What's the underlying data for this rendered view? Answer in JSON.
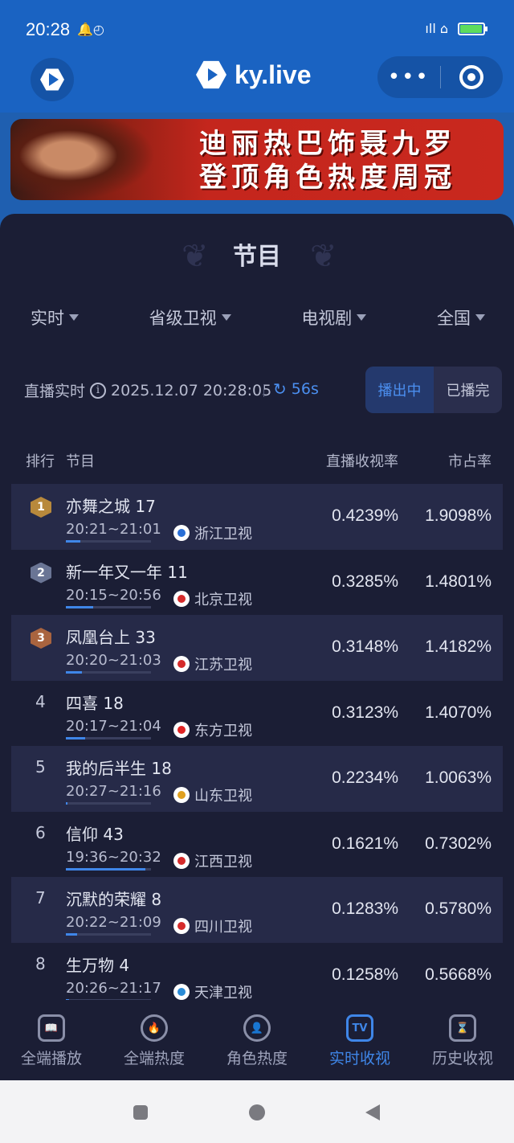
{
  "status": {
    "time": "20:28",
    "left_icons": "🔔◴",
    "right_icons": "ıll ⌂",
    "battery_level": 0.95
  },
  "header": {
    "brand": "ky.live",
    "more_label": "•••"
  },
  "banner": {
    "line1": "迪丽热巴饰聂九罗",
    "line2": "登顶角色热度周冠"
  },
  "panel": {
    "title": "节目",
    "filters": [
      "实时",
      "省级卫视",
      "电视剧",
      "全国"
    ],
    "live_label": "直播实时",
    "datetime": "2025.12.07 20:28:05",
    "refresh": "56s",
    "segments": [
      "播出中",
      "已播完"
    ],
    "columns": {
      "rank": "排行",
      "program": "节目",
      "rating": "直播收视率",
      "share": "市占率"
    }
  },
  "rows": [
    {
      "rank": "1",
      "name": "亦舞之城 17",
      "time": "20:21~21:01",
      "channel": "浙江卫视",
      "rating": "0.4239%",
      "share": "1.9098%",
      "progress": 0.17,
      "badge_color": "#b8893c",
      "logo_color": "#2a6fd6"
    },
    {
      "rank": "2",
      "name": "新一年又一年 11",
      "time": "20:15~20:56",
      "channel": "北京卫视",
      "rating": "0.3285%",
      "share": "1.4801%",
      "progress": 0.32,
      "badge_color": "#6a7595",
      "logo_color": "#d52b2b"
    },
    {
      "rank": "3",
      "name": "凤凰台上 33",
      "time": "20:20~21:03",
      "channel": "江苏卫视",
      "rating": "0.3148%",
      "share": "1.4182%",
      "progress": 0.19,
      "badge_color": "#a9643f",
      "logo_color": "#d52b2b"
    },
    {
      "rank": "4",
      "name": "四喜 18",
      "time": "20:17~21:04",
      "channel": "东方卫视",
      "rating": "0.3123%",
      "share": "1.4070%",
      "progress": 0.23,
      "logo_color": "#e02424"
    },
    {
      "rank": "5",
      "name": "我的后半生 18",
      "time": "20:27~21:16",
      "channel": "山东卫视",
      "rating": "0.2234%",
      "share": "1.0063%",
      "progress": 0.02,
      "logo_color": "#e0a020"
    },
    {
      "rank": "6",
      "name": "信仰 43",
      "time": "19:36~20:32",
      "channel": "江西卫视",
      "rating": "0.1621%",
      "share": "0.7302%",
      "progress": 0.93,
      "logo_color": "#d52b2b"
    },
    {
      "rank": "7",
      "name": "沉默的荣耀 8",
      "time": "20:22~21:09",
      "channel": "四川卫视",
      "rating": "0.1283%",
      "share": "0.5780%",
      "progress": 0.13,
      "logo_color": "#d52b2b"
    },
    {
      "rank": "8",
      "name": "生万物 4",
      "time": "20:26~21:17",
      "channel": "天津卫视",
      "rating": "0.1258%",
      "share": "0.5668%",
      "progress": 0.04,
      "logo_color": "#2a8bd6"
    }
  ],
  "bottom_nav": [
    {
      "label": "全端播放",
      "icon": "📖",
      "icon_name": "book-icon",
      "active": false
    },
    {
      "label": "全端热度",
      "icon": "🔥",
      "icon_name": "flame-icon",
      "active": false
    },
    {
      "label": "角色热度",
      "icon": "👤",
      "icon_name": "user-icon",
      "active": false
    },
    {
      "label": "实时收视",
      "icon": "TV",
      "icon_name": "tv-icon",
      "active": true
    },
    {
      "label": "历史收视",
      "icon": "⌛",
      "icon_name": "history-icon",
      "active": false
    }
  ]
}
